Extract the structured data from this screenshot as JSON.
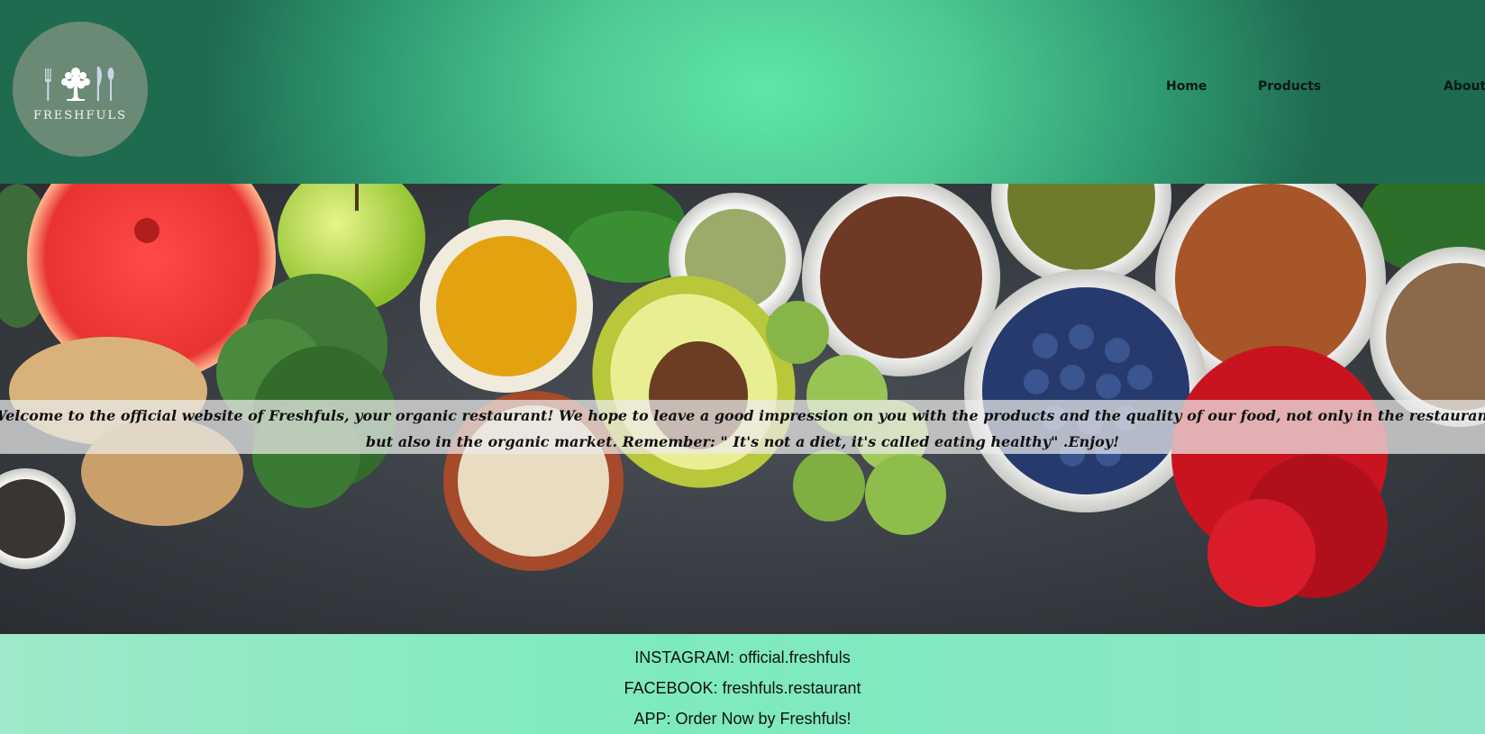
{
  "header": {
    "logo_text": "FRESHFULS",
    "logo_icon": "tree-fork-spoon-icon",
    "nav": [
      {
        "label": "Home"
      },
      {
        "label": "Products"
      },
      {
        "label": "About"
      }
    ]
  },
  "hero": {
    "image": "organic-food-bowls-image",
    "welcome": "Welcome to the official website of Freshfuls, your organic restaurant! We hope to leave a good impression on you with the products and the quality of our food, not only in the restaurant but also in the organic market. Remember: \" It's not a diet, it's called eating healthy\" .Enjoy!"
  },
  "footer": {
    "instagram": "INSTAGRAM: official.freshfuls",
    "facebook": "FACEBOOK: freshfuls.restaurant",
    "app": "APP: Order Now by Freshfuls!"
  },
  "colors": {
    "header_center": "#5fe6a8",
    "header_edge": "#1f6b50",
    "logo_bg": "#6b8a76",
    "footer_bg": "#7deabd"
  }
}
